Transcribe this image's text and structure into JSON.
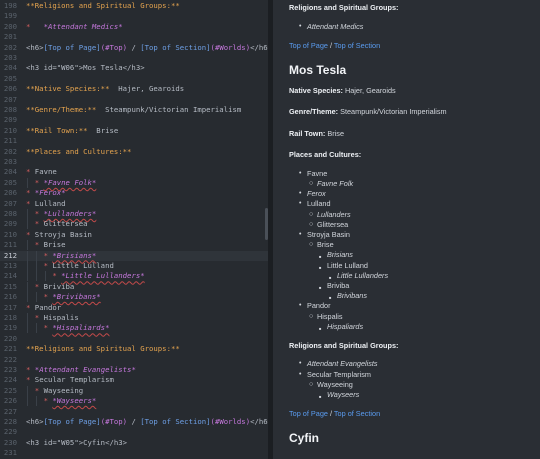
{
  "editor": {
    "lines": [
      {
        "n": "198",
        "s": [
          [
            "hdr",
            "**Religions and Spiritual Groups:**"
          ]
        ]
      },
      {
        "n": "199",
        "s": []
      },
      {
        "n": "200",
        "s": [
          [
            "bul",
            "* "
          ],
          [
            "em",
            "  *Attendant Medics*"
          ]
        ]
      },
      {
        "n": "201",
        "s": []
      },
      {
        "n": "202",
        "s": [
          [
            "tag",
            "<h6>"
          ],
          [
            "link",
            "[Top of Page]"
          ],
          [
            "url",
            "(#Top)"
          ],
          [
            "tag",
            " / "
          ],
          [
            "link",
            "[Top of Section]"
          ],
          [
            "url",
            "(#Worlds)"
          ],
          [
            "tag",
            "</h6>"
          ]
        ]
      },
      {
        "n": "203",
        "s": []
      },
      {
        "n": "204",
        "s": [
          [
            "tag",
            "<h3 id=\"W06\">Mos Tesla</h3>"
          ]
        ]
      },
      {
        "n": "205",
        "s": []
      },
      {
        "n": "206",
        "s": [
          [
            "hdr",
            "**Native Species:**"
          ],
          [
            "txt",
            "  Hajer, Gearoids"
          ]
        ]
      },
      {
        "n": "207",
        "s": []
      },
      {
        "n": "208",
        "s": [
          [
            "hdr",
            "**Genre/Theme:**"
          ],
          [
            "txt",
            "  Steampunk/Victorian Imperialism"
          ]
        ]
      },
      {
        "n": "209",
        "s": []
      },
      {
        "n": "210",
        "s": [
          [
            "hdr",
            "**Rail Town:**"
          ],
          [
            "txt",
            "  Brise"
          ]
        ]
      },
      {
        "n": "211",
        "s": []
      },
      {
        "n": "202",
        "s": [
          [
            "hdr",
            "**Places and Cultures:**"
          ]
        ]
      },
      {
        "n": "203",
        "s": []
      },
      {
        "n": "204",
        "s": [
          [
            "bul",
            "* "
          ],
          [
            "txt",
            "Favne"
          ]
        ]
      },
      {
        "n": "205",
        "s": [
          [
            "bul",
            "  * "
          ],
          [
            "em",
            "*Favne Folk*",
            "sq"
          ]
        ]
      },
      {
        "n": "206",
        "s": [
          [
            "bul",
            "* "
          ],
          [
            "em",
            "*Ferox*"
          ]
        ]
      },
      {
        "n": "207",
        "s": [
          [
            "bul",
            "* "
          ],
          [
            "txt",
            "Lulland"
          ]
        ]
      },
      {
        "n": "208",
        "s": [
          [
            "bul",
            "  * "
          ],
          [
            "em",
            "*Lullanders*",
            "sq"
          ]
        ]
      },
      {
        "n": "209",
        "s": [
          [
            "bul",
            "  * "
          ],
          [
            "txt",
            "Glittersea"
          ]
        ]
      },
      {
        "n": "210",
        "s": [
          [
            "bul",
            "* "
          ],
          [
            "txt",
            "Stroyja Basin"
          ]
        ]
      },
      {
        "n": "211",
        "s": [
          [
            "bul",
            "  * "
          ],
          [
            "txt",
            "Brise"
          ]
        ]
      },
      {
        "n": "212",
        "s": [
          [
            "bul",
            "    * "
          ],
          [
            "em",
            "*Brisians*",
            "sq"
          ]
        ],
        "current": true
      },
      {
        "n": "213",
        "s": [
          [
            "bul",
            "    * "
          ],
          [
            "txt",
            "Little Lulland"
          ]
        ]
      },
      {
        "n": "214",
        "s": [
          [
            "bul",
            "      * "
          ],
          [
            "em",
            "*Little Lullanders*",
            "sq"
          ]
        ]
      },
      {
        "n": "215",
        "s": [
          [
            "bul",
            "  * "
          ],
          [
            "txt",
            "Briviba"
          ]
        ]
      },
      {
        "n": "216",
        "s": [
          [
            "bul",
            "    * "
          ],
          [
            "em",
            "*Brivibans*",
            "sq"
          ]
        ]
      },
      {
        "n": "217",
        "s": [
          [
            "bul",
            "* "
          ],
          [
            "txt",
            "Pandor"
          ]
        ]
      },
      {
        "n": "218",
        "s": [
          [
            "bul",
            "  * "
          ],
          [
            "txt",
            "Hispalis"
          ]
        ]
      },
      {
        "n": "219",
        "s": [
          [
            "bul",
            "    * "
          ],
          [
            "em",
            "*Hispaliards*",
            "sq"
          ]
        ]
      },
      {
        "n": "220",
        "s": []
      },
      {
        "n": "221",
        "s": [
          [
            "hdr",
            "**Religions and Spiritual Groups:**"
          ]
        ]
      },
      {
        "n": "222",
        "s": []
      },
      {
        "n": "223",
        "s": [
          [
            "bul",
            "* "
          ],
          [
            "em",
            "*Attendant Evangelists*"
          ]
        ]
      },
      {
        "n": "224",
        "s": [
          [
            "bul",
            "* "
          ],
          [
            "txt",
            "Secular Templarism"
          ]
        ]
      },
      {
        "n": "225",
        "s": [
          [
            "bul",
            "  * "
          ],
          [
            "txt",
            "Wayseeing"
          ]
        ]
      },
      {
        "n": "226",
        "s": [
          [
            "bul",
            "    * "
          ],
          [
            "em",
            "*Wayseers*",
            "sq"
          ]
        ]
      },
      {
        "n": "227",
        "s": []
      },
      {
        "n": "228",
        "s": [
          [
            "tag",
            "<h6>"
          ],
          [
            "link",
            "[Top of Page]"
          ],
          [
            "url",
            "(#Top)"
          ],
          [
            "tag",
            " / "
          ],
          [
            "link",
            "[Top of Section]"
          ],
          [
            "url",
            "(#Worlds)"
          ],
          [
            "tag",
            "</h6>"
          ]
        ]
      },
      {
        "n": "229",
        "s": []
      },
      {
        "n": "230",
        "s": [
          [
            "tag",
            "<h3 id=\"W05\">Cyfin</h3>"
          ]
        ]
      },
      {
        "n": "231",
        "s": []
      }
    ]
  },
  "preview": {
    "blocks": [
      {
        "k": "bold",
        "t": "Religions and Spiritual Groups:"
      },
      {
        "k": "li",
        "d": 1,
        "i": true,
        "t": "Attendant Medics"
      },
      {
        "k": "links",
        "a": "Top of Page",
        "sep": " / ",
        "b": "Top of Section"
      },
      {
        "k": "h3",
        "t": "Mos Tesla"
      },
      {
        "k": "field",
        "label": "Native Species:",
        "val": " Hajer, Gearoids"
      },
      {
        "k": "field",
        "label": "Genre/Theme:",
        "val": " Steampunk/Victorian Imperialism"
      },
      {
        "k": "field",
        "label": "Rail Town:",
        "val": " Brise"
      },
      {
        "k": "bold",
        "t": "Places and Cultures:"
      },
      {
        "k": "li",
        "d": 1,
        "t": "Favne"
      },
      {
        "k": "li",
        "d": 2,
        "i": true,
        "t": "Favne Folk"
      },
      {
        "k": "li",
        "d": 1,
        "i": true,
        "t": "Ferox"
      },
      {
        "k": "li",
        "d": 1,
        "t": "Lulland"
      },
      {
        "k": "li",
        "d": 2,
        "i": true,
        "t": "Lullanders"
      },
      {
        "k": "li",
        "d": 2,
        "t": "Glittersea"
      },
      {
        "k": "li",
        "d": 1,
        "t": "Stroyja Basin"
      },
      {
        "k": "li",
        "d": 2,
        "t": "Brise"
      },
      {
        "k": "li",
        "d": 3,
        "i": true,
        "t": "Brisians"
      },
      {
        "k": "li",
        "d": 3,
        "t": "Little Lulland"
      },
      {
        "k": "li",
        "d": 4,
        "i": true,
        "t": "Little Lullanders"
      },
      {
        "k": "li",
        "d": 3,
        "t": "Briviba"
      },
      {
        "k": "li",
        "d": 4,
        "i": true,
        "t": "Brivibans"
      },
      {
        "k": "li",
        "d": 1,
        "t": "Pandor"
      },
      {
        "k": "li",
        "d": 2,
        "t": "Hispalis"
      },
      {
        "k": "li",
        "d": 3,
        "i": true,
        "t": "Hispaliards"
      },
      {
        "k": "bold",
        "t": "Religions and Spiritual Groups:"
      },
      {
        "k": "li",
        "d": 1,
        "i": true,
        "t": "Attendant Evangelists"
      },
      {
        "k": "li",
        "d": 1,
        "t": "Secular Templarism"
      },
      {
        "k": "li",
        "d": 2,
        "t": "Wayseeing"
      },
      {
        "k": "li",
        "d": 3,
        "i": true,
        "t": "Wayseers"
      },
      {
        "k": "links",
        "a": "Top of Page",
        "sep": " / ",
        "b": "Top of Section"
      },
      {
        "k": "h3",
        "t": "Cyfin"
      }
    ],
    "bullets": [
      "•",
      "○",
      "■",
      "■"
    ]
  },
  "colors": {
    "editor_bg": "#272b30",
    "preview_bg": "#2a2e34",
    "heading": "#e5a44f",
    "bullet": "#d65f5f",
    "emphasis": "#c678dd",
    "link": "#5a9cf0"
  }
}
